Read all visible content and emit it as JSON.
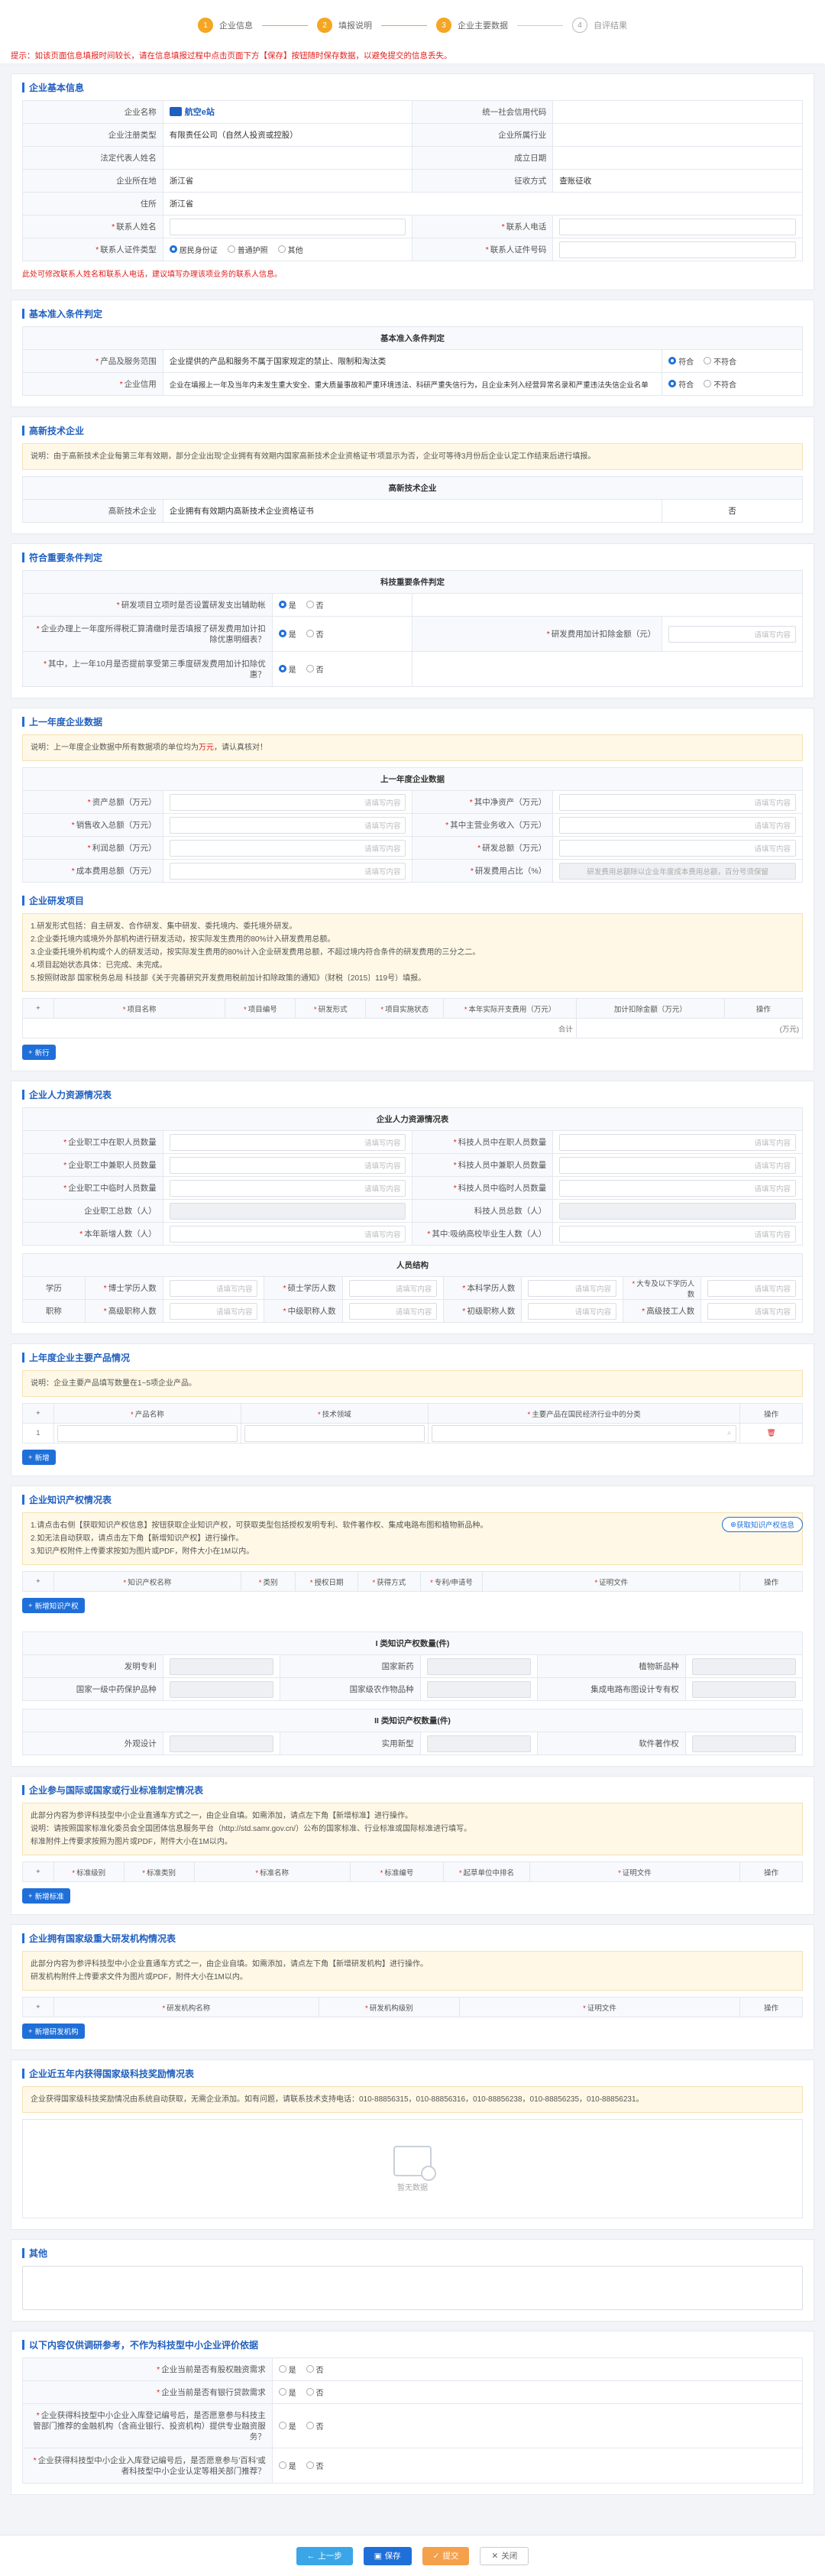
{
  "steps": [
    {
      "num": "1",
      "label": "企业信息"
    },
    {
      "num": "2",
      "label": "填报说明"
    },
    {
      "num": "3",
      "label": "企业主要数据"
    },
    {
      "num": "4",
      "label": "自评结果"
    }
  ],
  "tip": "提示：如该页面信息填报时间较长，请在信息填报过程中点击页面下方【保存】按钮随时保存数据，以避免提交的信息丢失。",
  "basic": {
    "title": "企业基本信息",
    "company_name_label": "企业名称",
    "company_name_value": "航空e站",
    "credit_code_label": "统一社会信用代码",
    "reg_type_label": "企业注册类型",
    "reg_type_value": "有限责任公司（自然人投资或控股）",
    "industry_label": "企业所属行业",
    "legal_label": "法定代表人姓名",
    "established_label": "成立日期",
    "region_label": "企业所在地",
    "region_value": "浙江省",
    "tax_label": "征收方式",
    "tax_value": "查账征收",
    "address_label": "住所",
    "address_value": "浙江省",
    "contact_name_label": "联系人姓名",
    "contact_phone_label": "联系人电话",
    "contact_id_type_label": "联系人证件类型",
    "id_types": [
      "居民身份证",
      "普通护照",
      "其他"
    ],
    "contact_id_no_label": "联系人证件号码",
    "placeholder": "请填写内容",
    "warning": "此处可修改联系人姓名和联系人电话，建议填写办理该项业务的联系人信息。"
  },
  "basic_conditions": {
    "title": "基本准入条件判定",
    "head": "基本准入条件判定",
    "rows": [
      {
        "label": "产品及服务范围",
        "text": "企业提供的产品和服务不属于国家规定的禁止、限制和淘汰类"
      },
      {
        "label": "企业信用",
        "text": "企业在填报上一年及当年内未发生重大安全、重大质量事故和严重环境违法、科研严重失信行为，且企业未列入经营异常名录和严重违法失信企业名单"
      }
    ],
    "yes": "符合",
    "no": "不符合"
  },
  "hightech": {
    "title": "高新技术企业",
    "notice": "说明：由于高新技术企业每第三年有效期，部分企业出现'企业拥有有效期内国家高新技术企业资格证书'项显示为否，企业可等待3月份后企业认定工作结束后进行填报。",
    "head": "高新技术企业",
    "label": "高新技术企业",
    "text": "企业拥有有效期内高新技术企业资格证书",
    "value": "否"
  },
  "special": {
    "title": "符合重要条件判定",
    "head": "科技重要条件判定",
    "q1": "研发项目立项时是否设置研发支出辅助帐",
    "q2": "企业办理上一年度所得税汇算清缴时是否填报了研发费用加计扣除优惠明细表？",
    "q2_right": "研发费用加计扣除金额（元）",
    "q3": "其中，上一年10月是否提前享受第三季度研发费用加计扣除优惠？",
    "yes": "是",
    "no": "否"
  },
  "lastyear": {
    "title": "上一年度企业数据",
    "notice_a": "说明：上一年度企业数据中所有数据项的单位均为",
    "notice_unit": "万元",
    "notice_b": "，请认真核对！",
    "head": "上一年度企业数据",
    "rows": [
      [
        "资产总额（万元）",
        "其中净资产（万元）"
      ],
      [
        "销售收入总额（万元）",
        "其中主营业务收入（万元）"
      ],
      [
        "利润总额（万元）",
        "研发总额（万元）"
      ],
      [
        "成本费用总额（万元）",
        "研发费用占比（%）"
      ]
    ],
    "ratio_hint": "研发费用总额除以企业年度成本费用总额，百分号须保留"
  },
  "rd": {
    "title": "企业研发项目",
    "notes": [
      "1.研发形式包括：自主研发、合作研发、集中研发、委托境内、委托境外研发。",
      "2.企业委托境内或境外外部机构进行研发活动，按实际发生费用的80%计入研发费用总额。",
      "3.企业委托境外机构或个人的研发活动，按实际发生费用的80%计入企业研发费用总额，不超过境内符合条件的研发费用的三分之二。",
      "4.项目起始状态具体：已完成、未完成。",
      "5.按照财政部 国家税务总局 科技部《关于完善研究开发费用税前加计扣除政策的通知》（财税〔2015〕119号）填报。"
    ],
    "columns": [
      "项目名称",
      "项目编号",
      "研发形式",
      "项目实施状态",
      "本年实际开支费用（万元）",
      "加计扣除金额（万元）",
      "操作"
    ],
    "total_label": "合计",
    "total_unit": "万元",
    "add": "新行"
  },
  "hr": {
    "title": "企业人力资源情况表",
    "head": "企业人力资源情况表",
    "rows": [
      [
        "企业职工中在职人员数量",
        "科技人员中在职人员数量"
      ],
      [
        "企业职工中兼职人员数量",
        "科技人员中兼职人员数量"
      ],
      [
        "企业职工中临时人员数量",
        "科技人员中临时人员数量"
      ],
      [
        "企业职工总数（人）",
        "科技人员总数（人）"
      ],
      [
        "本年新增人数（人）",
        "其中:吸纳高校毕业生人数（人）"
      ]
    ],
    "struct_head": "人员结构",
    "edu_label": "学历",
    "edu": [
      "博士学历人数",
      "硕士学历人数",
      "本科学历人数",
      "大专及以下学历人数"
    ],
    "title_label": "职称",
    "titles": [
      "高级职称人数",
      "中级职称人数",
      "初级职称人数",
      "高级技工人数"
    ]
  },
  "products": {
    "title": "上年度企业主要产品情况",
    "notice": "说明：企业主要产品填写数量在1~5项企业产品。",
    "columns": [
      "产品名称",
      "技术领域",
      "主要产品在国民经济行业中的分类",
      "操作"
    ],
    "row_no": "1",
    "add": "新增"
  },
  "ip": {
    "title": "企业知识产权情况表",
    "notes": [
      "1.请点击右侧【获取知识产权信息】按钮获取企业知识产权，可获取类型包括授权发明专利、软件著作权、集成电路布图和植物新品种。",
      "2.如无法自动获取，请点击左下角【新增知识产权】进行操作。",
      "3.知识产权附件上传要求按如为图片或PDF，附件大小在1M以内。"
    ],
    "fetch_btn": "获取知识产权信息",
    "columns": [
      "知识产权名称",
      "类别",
      "授权日期",
      "获得方式",
      "专利/申请号",
      "证明文件",
      "操作"
    ],
    "add": "新增知识产权",
    "class1_head": "I 类知识产权数量(件)",
    "class1_rows": [
      [
        "发明专利",
        "国家新药",
        "植物新品种"
      ],
      [
        "国家一级中药保护品种",
        "国家级农作物品种",
        "集成电路布图设计专有权"
      ]
    ],
    "class2_head": "II 类知识产权数量(件)",
    "class2_row": [
      "外观设计",
      "实用新型",
      "软件著作权"
    ]
  },
  "standards": {
    "title": "企业参与国际或国家或行业标准制定情况表",
    "notes": [
      "此部分内容为参评科技型中小企业直通车方式之一，由企业自填。如需添加，请点左下角【新增标准】进行操作。",
      "说明：请按照国家标准化委员会全国团体信息服务平台（http://std.samr.gov.cn/）公布的国家标准、行业标准或国际标准进行填写。",
      "标准附件上传要求按照为图片或PDF，附件大小在1M以内。"
    ],
    "columns": [
      "标准级别",
      "标准类别",
      "标准名称",
      "标准编号",
      "起草单位中排名",
      "证明文件",
      "操作"
    ],
    "add": "新增标准"
  },
  "platforms": {
    "title": "企业拥有国家级重大研发机构情况表",
    "notes": [
      "此部分内容为参评科技型中小企业直通车方式之一，由企业自填。如需添加，请点左下角【新增研发机构】进行操作。",
      "研发机构附件上传要求文件为图片或PDF，附件大小在1M以内。"
    ],
    "columns": [
      "研发机构名称",
      "研发机构级别",
      "证明文件",
      "操作"
    ],
    "add": "新增研发机构"
  },
  "awards": {
    "title": "企业近五年内获得国家级科技奖励情况表",
    "notice": "企业获得国家级科技奖励情况由系统自动获取，无需企业添加。如有问题，请联系技术支持电话：010-88856315，010-88856316，010-88856238，010-88856235，010-88856231。",
    "empty": "暂无数据"
  },
  "remarks": {
    "title": "其他"
  },
  "survey": {
    "title": "以下内容仅供调研参考，不作为科技型中小企业评价依据",
    "questions": [
      "企业当前是否有股权融资需求",
      "企业当前是否有银行贷款需求",
      "企业获得科技型中小企业入库登记编号后，是否愿意参与科技主管部门推荐的金融机构（含商业银行、投资机构）提供专业融资服务？",
      "企业获得科技型中小企业入库登记编号后，是否愿意参与'百科'或者科技型中小企业认定等相关部门推荐？"
    ],
    "yes": "是",
    "no": "否"
  },
  "footer": {
    "prev": "上一步",
    "save": "保存",
    "submit": "提交",
    "close": "关闭"
  }
}
